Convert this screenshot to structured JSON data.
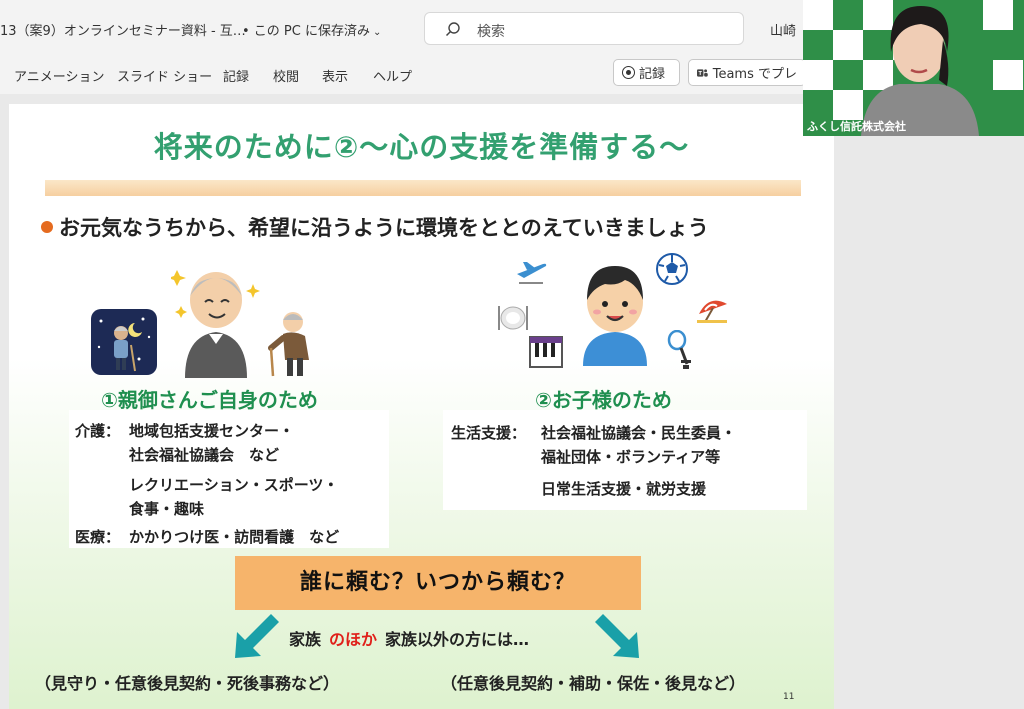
{
  "titlebar": {
    "doc_title": "13（案9）オンラインセミナー資料 - 互…",
    "save_status": "• この PC に保存済み",
    "search_placeholder": "検索",
    "user": "山崎"
  },
  "ribbon": {
    "tabs": [
      "アニメーション",
      "スライド ショー",
      "記録",
      "校閲",
      "表示",
      "ヘルプ"
    ],
    "record_button": "記録",
    "teams_button": "Teams でプレ"
  },
  "slide": {
    "title": "将来のために②～心の支援を準備する～",
    "bullet": "お元気なうちから、希望に沿うように環境をととのえていきましょう",
    "left": {
      "heading": "①親御さんご自身のため",
      "kaigo_label": "介護：",
      "kaigo_line1": "地域包括支援センター・",
      "kaigo_line2": "社会福祉協議会　など",
      "rec_line1": "レクリエーション・スポーツ・",
      "rec_line2": "食事・趣味",
      "iryo_label": "医療：",
      "iryo_text": "かかりつけ医・訪問看護　など"
    },
    "right": {
      "heading": "②お子様のため",
      "seikatsu_label": "生活支援：",
      "seikatsu_line1": "社会福祉協議会・民生委員・",
      "seikatsu_line2": "福祉団体・ボランティア等",
      "nichijo": "日常生活支援・就労支援"
    },
    "callout": "誰に頼む？いつから頼む？",
    "family_prefix": "家族",
    "family_red": "のほか",
    "family_suffix": "家族以外の方には…",
    "foot_left": "（見守り・任意後見契約・死後事務など）",
    "foot_right": "（任意後見契約・補助・保佐・後見など）",
    "page_number": "11"
  },
  "webcam": {
    "label": "ふくし信託株式会社"
  },
  "colors": {
    "title_green": "#33a070",
    "heading_green": "#1f8f4f",
    "callout_orange": "#f6b46b",
    "accent_red": "#e0201a",
    "bullet_orange": "#e56b1f",
    "arrow_teal": "#1aa0a8"
  }
}
